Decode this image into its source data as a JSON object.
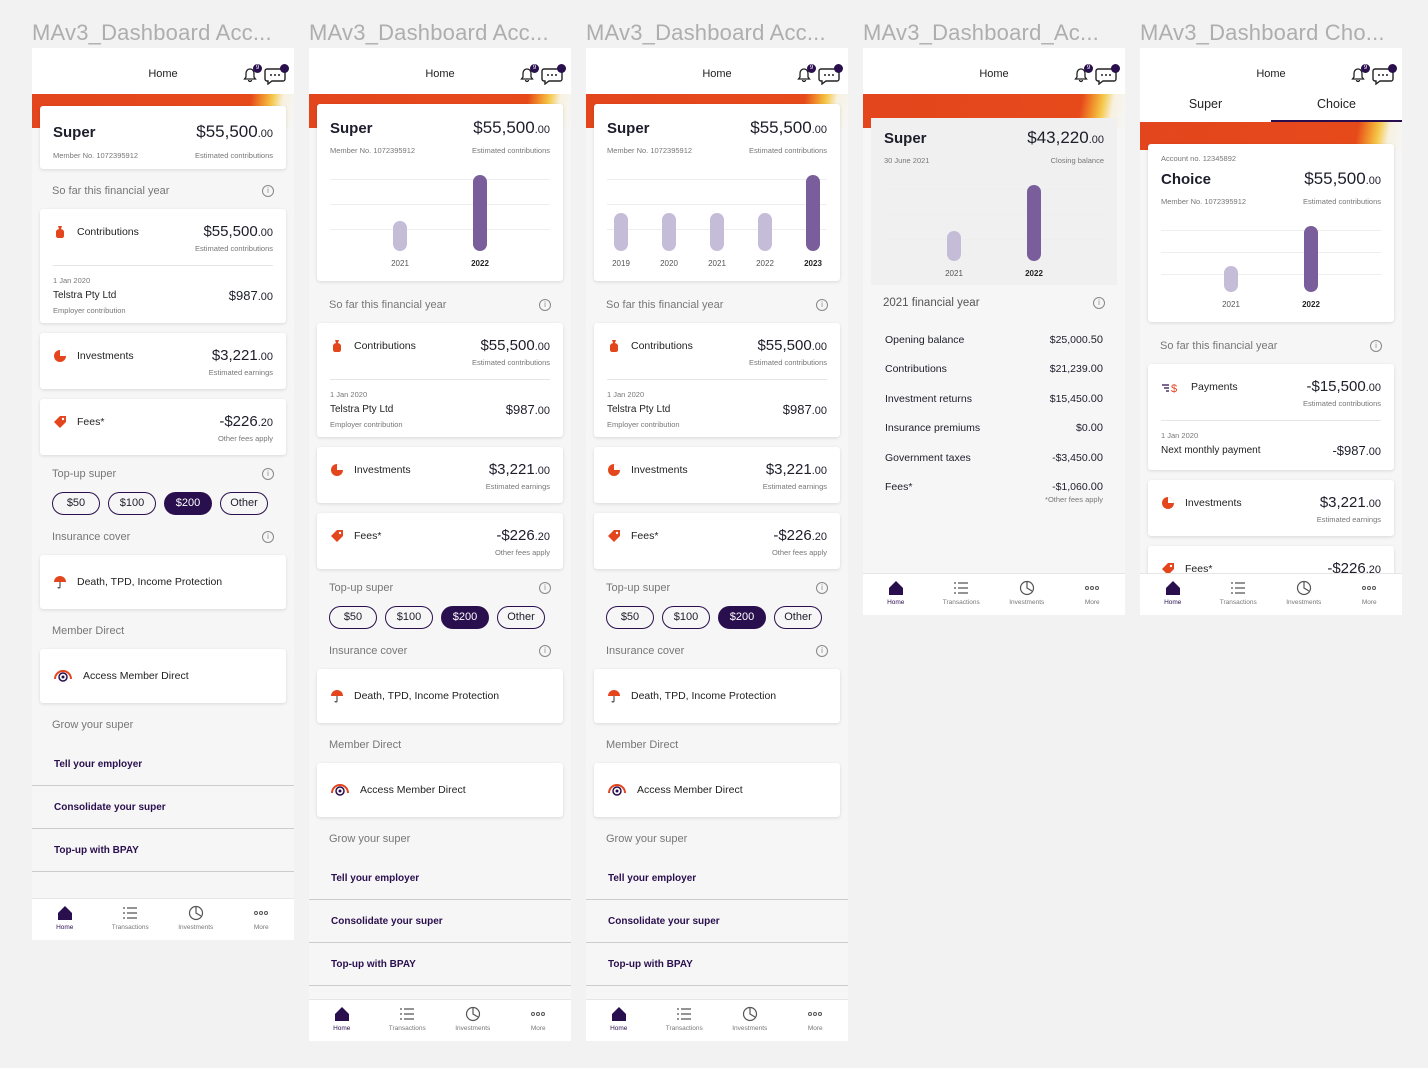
{
  "frames": [
    {
      "title": "MAv3_Dashboard Acc..."
    },
    {
      "title": "MAv3_Dashboard Acc..."
    },
    {
      "title": "MAv3_Dashboard Acc..."
    },
    {
      "title": "MAv3_Dashboard_Ac..."
    },
    {
      "title": "MAv3_Dashboard Cho..."
    }
  ],
  "header": {
    "title": "Home",
    "notif_count": "9"
  },
  "super": {
    "label": "Super",
    "amount": "$55,500",
    "cents": ".00",
    "member": "Member No. 1072395912",
    "est": "Estimated contributions"
  },
  "super_closing": {
    "label": "Super",
    "amount": "$43,220",
    "cents": ".00",
    "date": "30 June 2021",
    "note": "Closing balance"
  },
  "choice": {
    "account": "Account no. 12345892",
    "label": "Choice",
    "amount": "$55,500",
    "cents": ".00",
    "member": "Member No. 1072395912",
    "est": "Estimated contributions"
  },
  "tabs_top": {
    "super": "Super",
    "choice": "Choice"
  },
  "sections": {
    "fy": "So far this financial year",
    "topup": "Top-up super",
    "insurance": "Insurance cover",
    "member_direct": "Member Direct",
    "grow": "Grow your super",
    "fy2021": "2021 financial year"
  },
  "contributions": {
    "label": "Contributions",
    "amount": "$55,500",
    "cents": ".00",
    "est": "Estimated contributions",
    "date": "1 Jan 2020",
    "employer": "Telstra Pty Ltd",
    "employer_sub": "Employer contribution",
    "emp_amount": "$987",
    "emp_cents": ".00"
  },
  "investments": {
    "label": "Investments",
    "amount": "$3,221",
    "cents": ".00",
    "sub": "Estimated earnings"
  },
  "fees": {
    "label": "Fees*",
    "amount": "-$226",
    "cents": ".20",
    "sub": "Other fees apply"
  },
  "fees_partial": {
    "label": "Fees*",
    "amount": "-$226",
    "cents": ".20"
  },
  "payments": {
    "label": "Payments",
    "amount": "-$15,500",
    "cents": ".00",
    "est": "Estimated contributions",
    "date": "1 Jan 2020",
    "next": "Next monthly payment",
    "next_amount": "-$987",
    "next_cents": ".00"
  },
  "topup_chips": [
    "$50",
    "$100",
    "$200",
    "Other"
  ],
  "insurance_item": "Death, TPD, Income Protection",
  "member_direct_item": "Access Member Direct",
  "grow_links": [
    "Tell your employer",
    "Consolidate your super",
    "Top-up with BPAY"
  ],
  "tabbar": [
    "Home",
    "Transactions",
    "Investments",
    "More"
  ],
  "balances": [
    {
      "label": "Opening balance",
      "amount": "$25,000",
      "cents": ".50"
    },
    {
      "label": "Contributions",
      "amount": "$21,239",
      "cents": ".00"
    },
    {
      "label": "Investment returns",
      "amount": "$15,450",
      "cents": ".00"
    },
    {
      "label": "Insurance premiums",
      "amount": "$0",
      "cents": ".00"
    },
    {
      "label": "Government taxes",
      "amount": "-$3,450",
      "cents": ".00"
    },
    {
      "label": "Fees*",
      "amount": "-$1,060",
      "cents": ".00"
    }
  ],
  "balances_note": "*Other fees apply",
  "chart_data": [
    {
      "type": "bar",
      "categories": [
        "2021",
        "2022"
      ],
      "values": [
        0.4,
        1.0
      ],
      "highlight": "2022",
      "colors": {
        "past": "#c5bcd8",
        "current": "#7a5e9b"
      }
    },
    {
      "type": "bar",
      "categories": [
        "2019",
        "2020",
        "2021",
        "2022",
        "2023"
      ],
      "values": [
        0.5,
        0.5,
        0.5,
        0.5,
        1.0
      ],
      "highlight": "2023",
      "colors": {
        "past": "#c5bcd8",
        "current": "#7a5e9b"
      }
    }
  ]
}
